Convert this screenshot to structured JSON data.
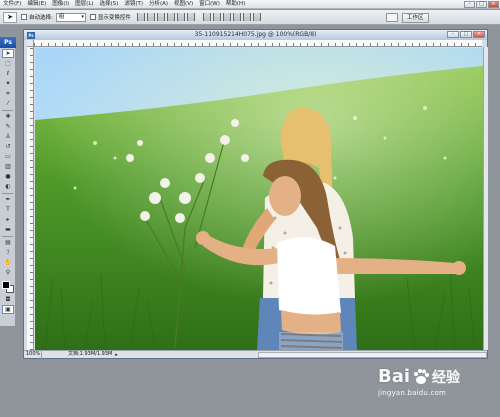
{
  "menubar": {
    "items": [
      "文件(F)",
      "编辑(E)",
      "图像(I)",
      "图层(L)",
      "选择(S)",
      "滤镜(T)",
      "分析(A)",
      "视图(V)",
      "窗口(W)",
      "帮助(H)"
    ]
  },
  "options": {
    "auto_select_label": "自动选择:",
    "auto_select_value": "组",
    "show_transform_label": "显示变换控件",
    "workspace_label": "工作区"
  },
  "toolbox": {
    "badge": "Ps",
    "tools": [
      "move",
      "marquee",
      "lasso",
      "magic-wand",
      "crop",
      "slice",
      "healing",
      "brush",
      "stamp",
      "history-brush",
      "eraser",
      "gradient",
      "blur",
      "dodge",
      "pen",
      "type",
      "path-select",
      "shape",
      "notes",
      "eyedropper",
      "hand",
      "zoom"
    ]
  },
  "document": {
    "title": "35-110915214H075.jpg @ 100%(RGB/8)",
    "zoom": "100%",
    "doc_size": "文档:1.93M/1.93M"
  },
  "watermark": {
    "logo_text": "Bai",
    "logo_text2": "经验",
    "url": "jingyan.baidu.com"
  },
  "colors": {
    "accent": "#2a64b4",
    "workspace_bg": "#8f959b"
  }
}
